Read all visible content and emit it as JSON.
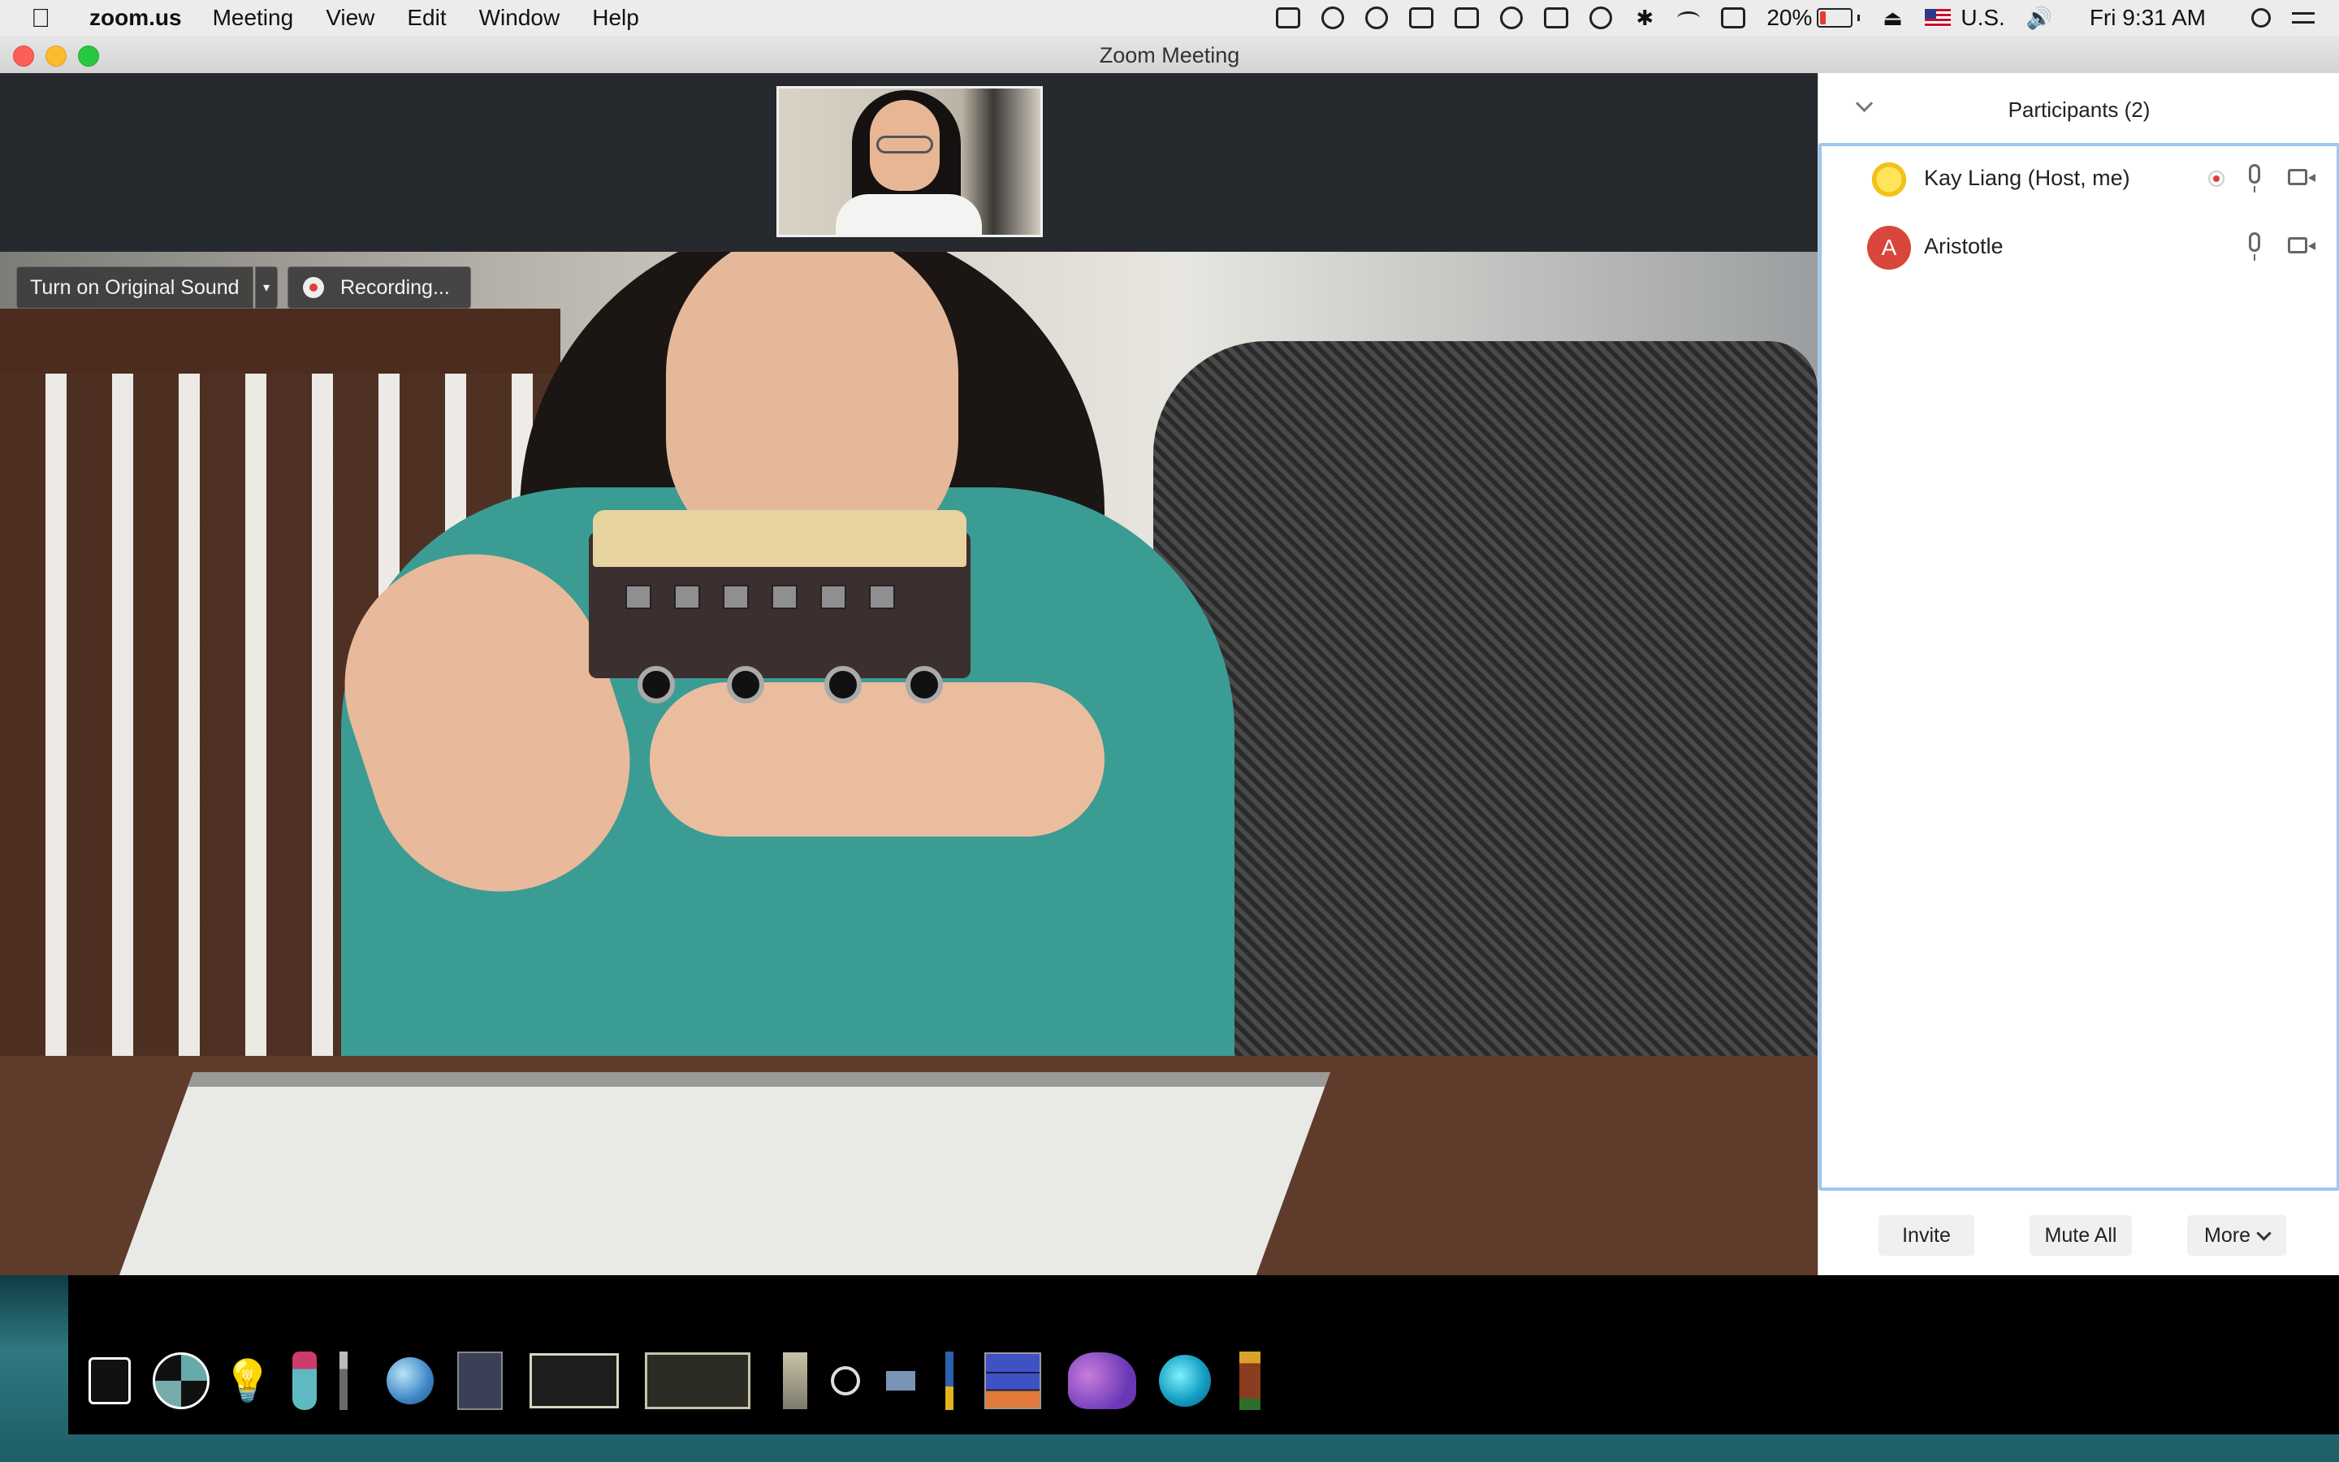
{
  "menubar": {
    "app_name": "zoom.us",
    "menus": [
      "Meeting",
      "View",
      "Edit",
      "Window",
      "Help"
    ],
    "battery_text": "20%",
    "battery_level": 0.2,
    "input_source": "U.S.",
    "clock": "Fri 9:31 AM"
  },
  "window": {
    "title": "Zoom Meeting"
  },
  "video": {
    "original_sound_label": "Turn on Original Sound",
    "recording_label": "Recording..."
  },
  "participants": {
    "title": "Participants (2)",
    "list": [
      {
        "name": "Kay Liang (Host, me)",
        "avatar": "star-avatar",
        "recording": true
      },
      {
        "name": "Aristotle",
        "avatar_letter": "A",
        "avatar_color": "#d9463b",
        "recording": false
      }
    ],
    "invite_label": "Invite",
    "mute_all_label": "Mute All",
    "more_label": "More"
  },
  "dock": {
    "icons": [
      "dice-icon",
      "gem-wheel-icon",
      "bulb-icon",
      "bottle-icon",
      "paintbrush-icon",
      "globe-icon",
      "card-icon",
      "chalkboard-icon",
      "chalkboard-wide-icon",
      "column-icon",
      "magnifier-icon",
      "hammer-icon",
      "brush-icon",
      "stacked-books-icon",
      "dinosaur-icon",
      "gem-icon",
      "lantern-icon"
    ]
  },
  "colors": {
    "accent_blue": "#9ec6ef",
    "recording_red": "#e0403a",
    "avatar_red": "#d9463b"
  }
}
